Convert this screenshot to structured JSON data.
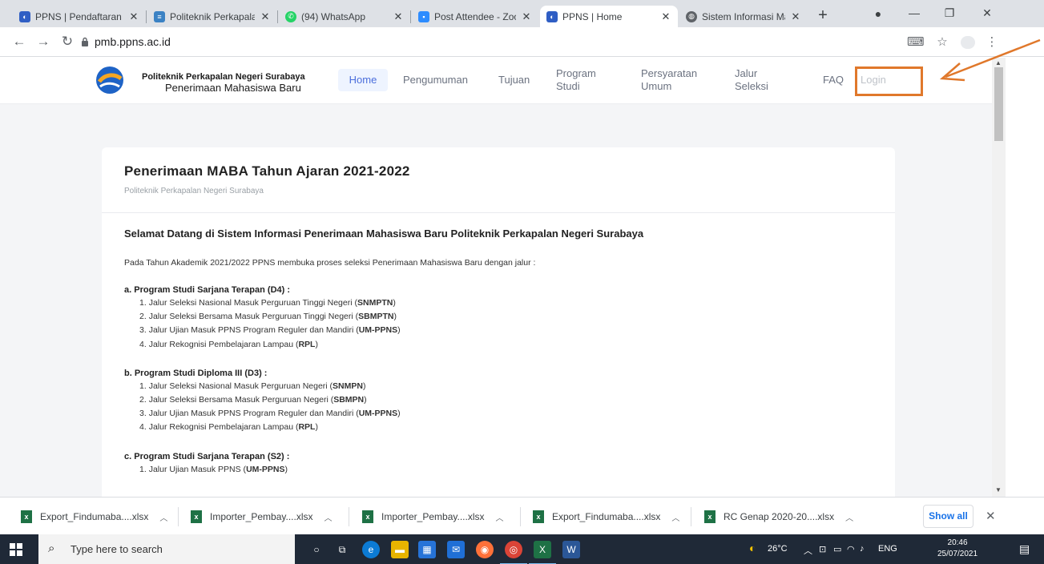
{
  "browser": {
    "tabs": [
      {
        "label": "PPNS | Pendaftaran M",
        "active": false
      },
      {
        "label": "Politeknik Perkapalan N",
        "active": false
      },
      {
        "label": "(94) WhatsApp",
        "active": false
      },
      {
        "label": "Post Attendee - Zoom",
        "active": false
      },
      {
        "label": "PPNS | Home",
        "active": true
      },
      {
        "label": "Sistem Informasi Mana",
        "active": false
      }
    ],
    "url": "pmb.ppns.ac.id"
  },
  "site": {
    "brand_line1": "Politeknik Perkapalan Negeri Surabaya",
    "brand_line2": "Penerimaan Mahasiswa Baru",
    "nav": {
      "home": "Home",
      "pengumuman": "Pengumuman",
      "tujuan": "Tujuan",
      "program_studi_1": "Program",
      "program_studi_2": "Studi",
      "persyaratan_1": "Persyaratan",
      "persyaratan_2": "Umum",
      "jalur_1": "Jalur",
      "jalur_2": "Seleksi",
      "faq": "FAQ",
      "login": "Login"
    }
  },
  "content": {
    "title": "Penerimaan MABA Tahun Ajaran 2021-2022",
    "subtitle": "Politeknik Perkapalan Negeri Surabaya",
    "welcome": "Selamat Datang di Sistem Informasi Penerimaan Mahasiswa Baru Politeknik Perkapalan Negeri Surabaya",
    "intro": "Pada Tahun Akademik 2021/2022 PPNS membuka proses seleksi Penerimaan Mahasiswa Baru dengan jalur :",
    "sections": [
      {
        "heading": "a. Program Studi Sarjana Terapan (D4) :",
        "items": [
          {
            "num": "1.",
            "text": "Jalur Seleksi Nasional Masuk Perguruan Tinggi Negeri (",
            "bold": "SNMPTN",
            "end": ")"
          },
          {
            "num": "2.",
            "text": "Jalur Seleksi Bersama Masuk Perguruan Tinggi Negeri (",
            "bold": "SBMPTN",
            "end": ")"
          },
          {
            "num": "3.",
            "text": "Jalur Ujian Masuk PPNS Program Reguler dan Mandiri (",
            "bold": "UM-PPNS",
            "end": ")"
          },
          {
            "num": "4.",
            "text": "Jalur Rekognisi Pembelajaran Lampau (",
            "bold": "RPL",
            "end": ")"
          }
        ]
      },
      {
        "heading": "b. Program Studi Diploma III (D3) :",
        "items": [
          {
            "num": "1.",
            "text": "Jalur Seleksi Nasional Masuk Perguruan Negeri (",
            "bold": "SNMPN",
            "end": ")"
          },
          {
            "num": "2.",
            "text": "Jalur Seleksi Bersama Masuk Perguruan Negeri (",
            "bold": "SBMPN",
            "end": ")"
          },
          {
            "num": "3.",
            "text": "Jalur Ujian Masuk PPNS Program Reguler dan Mandiri (",
            "bold": "UM-PPNS",
            "end": ")"
          },
          {
            "num": "4.",
            "text": "Jalur Rekognisi Pembelajaran Lampau (",
            "bold": "RPL",
            "end": ")"
          }
        ]
      },
      {
        "heading": "c. Program Studi Sarjana Terapan (S2) :",
        "items": [
          {
            "num": "1.",
            "text": "Jalur Ujian Masuk PPNS (",
            "bold": "UM-PPNS",
            "end": ")"
          }
        ]
      }
    ]
  },
  "downloads": {
    "items": [
      "Export_Findumaba....xlsx",
      "Importer_Pembay....xlsx",
      "Importer_Pembay....xlsx",
      "Export_Findumaba....xlsx",
      "RC Genap 2020-20....xlsx"
    ],
    "show_all": "Show all"
  },
  "taskbar": {
    "search_placeholder": "Type here to search",
    "weather": "26°C",
    "lang": "ENG",
    "time": "20:46",
    "date": "25/07/2021"
  },
  "colors": {
    "annotation": "#e0782b",
    "nav_active": "#4b6edc"
  }
}
